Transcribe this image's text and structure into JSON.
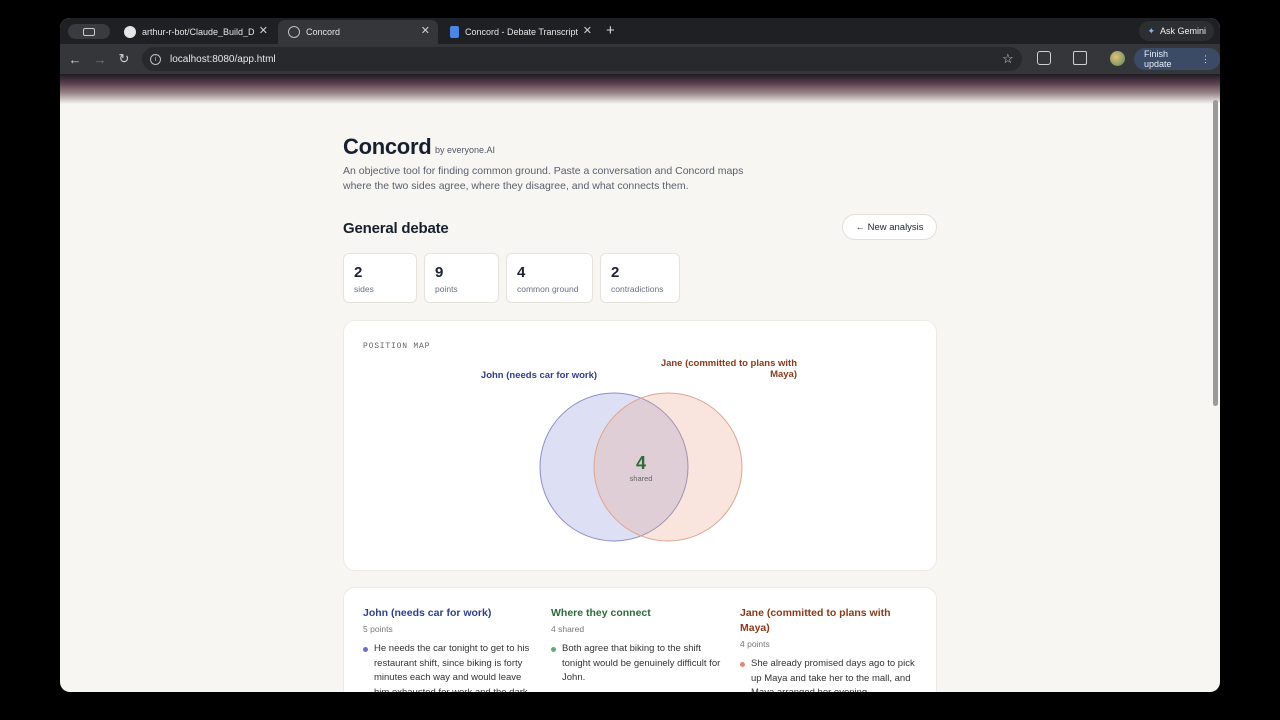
{
  "browser": {
    "tabs": [
      {
        "title": "arthur-r-bot/Claude_Build_D",
        "icon": "github-icon"
      },
      {
        "title": "Concord",
        "icon": "globe-icon"
      },
      {
        "title": "Concord - Debate Transcript",
        "icon": "docs-icon"
      }
    ],
    "gemini_label": "Ask Gemini",
    "url": "localhost:8080/app.html",
    "finish_update_label": "Finish update"
  },
  "app": {
    "name": "Concord",
    "byline": "by everyone.AI",
    "description": "An objective tool for finding common ground. Paste a conversation and Concord maps where the two sides agree, where they disagree, and what connects them."
  },
  "analysis": {
    "title": "General debate",
    "new_analysis_label": "← New analysis",
    "stats": [
      {
        "value": "2",
        "label": "sides"
      },
      {
        "value": "9",
        "label": "points"
      },
      {
        "value": "4",
        "label": "common ground"
      },
      {
        "value": "2",
        "label": "contradictions"
      }
    ]
  },
  "position_map": {
    "label": "POSITION MAP",
    "left_name": "John (needs car for work)",
    "right_name": "Jane (committed to plans with Maya)",
    "shared_count": "4",
    "shared_label": "shared"
  },
  "columns": [
    {
      "title": "John (needs car for work)",
      "sub": "5 points",
      "color": "#2f3f8a",
      "dot": "#6b70c8",
      "bullets": [
        "He needs the car tonight to get to his restaurant shift, since biking is forty minutes each way and would leave him exhausted for work and the dark"
      ]
    },
    {
      "title": "Where they connect",
      "sub": "4 shared",
      "color": "#2e6a3c",
      "dot": "#5fae78",
      "bullets": [
        "Both agree that biking to the shift tonight would be genuinely difficult for John."
      ]
    },
    {
      "title": "Jane (committed to plans with Maya)",
      "sub": "4 points",
      "color": "#8a3a1a",
      "dot": "#e08a78",
      "bullets": [
        "She already promised days ago to pick up Maya and take her to the mall, and Maya arranged her evening"
      ]
    }
  ],
  "colors": {
    "accent_blue": "#2f3f8a",
    "accent_orange": "#8a3a1a",
    "accent_green": "#2e6a3c"
  }
}
